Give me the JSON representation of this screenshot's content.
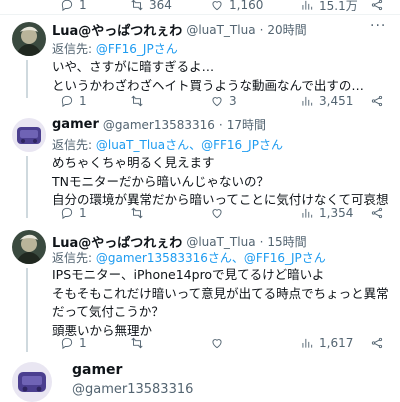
{
  "top_row": {
    "replies": "1",
    "retweets": "364",
    "likes": "1,160",
    "views": "15.1万"
  },
  "tweets": [
    {
      "name": "Lua@やっぱつれぇわ",
      "handle": "@luaT_Tlua",
      "sep": "·",
      "time": "20時間",
      "reply_label": "返信先: ",
      "reply_mention": "@FF16_JPさん",
      "lines": [
        "いや、さすがに暗すぎるよ…",
        "というかわざわざヘイト買うような動画なんで出すの…"
      ],
      "stats": {
        "replies": "1",
        "retweets": "",
        "likes": "3",
        "views": "3,451"
      }
    },
    {
      "name": "gamer",
      "handle": "@gamer13583316",
      "sep": "·",
      "time": "17時間",
      "reply_label": "返信先: ",
      "reply_mention": "@luaT_Tluaさん、@FF16_JPさん",
      "lines": [
        "めちゃくちゃ明るく見えます",
        "TNモニターだから暗いんじゃないの？",
        "自分の環境が異常だから暗いってことに気付けなくて可哀想"
      ],
      "stats": {
        "replies": "1",
        "retweets": "",
        "likes": "",
        "views": "1,354"
      }
    },
    {
      "name": "Lua@やっぱつれぇわ",
      "handle": "@luaT_Tlua",
      "sep": "·",
      "time": "15時間",
      "reply_label": "返信先: ",
      "reply_mention": "@gamer13583316さん、@FF16_JPさん",
      "lines": [
        "IPSモニター、iPhone14proで見てるけど暗いよ",
        "そもそもこれだけ暗いって意見が出てる時点でちょっと異常",
        "だって気付こうか？",
        "頭悪いから無理か"
      ],
      "stats": {
        "replies": "1",
        "retweets": "",
        "likes": "",
        "views": "1,617"
      }
    }
  ],
  "last": {
    "name": "gamer",
    "handle": "@gamer13583316"
  }
}
